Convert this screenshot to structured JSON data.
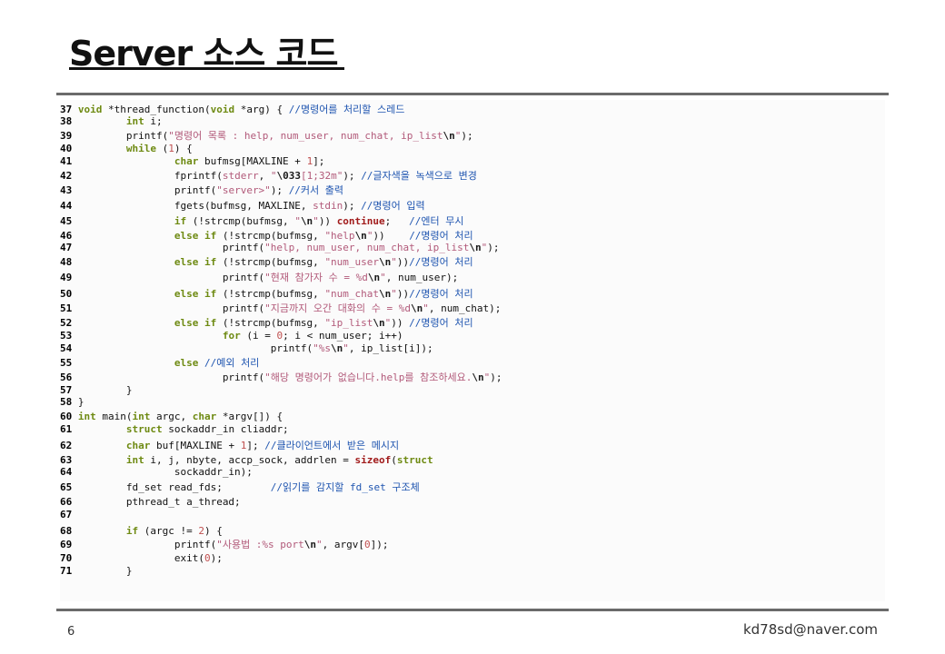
{
  "slide": {
    "title": "Server 소스 코드",
    "page_number": "6",
    "email": "kd78sd@naver.com"
  },
  "code_lines": [
    {
      "n": "37",
      "t": "void *thread_function(void *arg) { //명령어를 처리할 스레드"
    },
    {
      "n": "38",
      "t": "        int i;"
    },
    {
      "n": "39",
      "t": "        printf(\"명령어 목록 : help, num_user, num_chat, ip_list\\n\");"
    },
    {
      "n": "40",
      "t": "        while (1) {"
    },
    {
      "n": "41",
      "t": "                char bufmsg[MAXLINE + 1];"
    },
    {
      "n": "42",
      "t": "                fprintf(stderr, \"\\033[1;32m\"); //글자색을 녹색으로 변경"
    },
    {
      "n": "43",
      "t": "                printf(\"server>\"); //커서 출력"
    },
    {
      "n": "44",
      "t": "                fgets(bufmsg, MAXLINE, stdin); //명령어 입력"
    },
    {
      "n": "45",
      "t": "                if (!strcmp(bufmsg, \"\\n\")) continue;   //엔터 무시"
    },
    {
      "n": "46",
      "t": "                else if (!strcmp(bufmsg, \"help\\n\"))    //명령어 처리"
    },
    {
      "n": "47",
      "t": "                        printf(\"help, num_user, num_chat, ip_list\\n\");"
    },
    {
      "n": "48",
      "t": "                else if (!strcmp(bufmsg, \"num_user\\n\"))//명령어 처리"
    },
    {
      "n": "49",
      "t": "                        printf(\"현재 참가자 수 = %d\\n\", num_user);"
    },
    {
      "n": "50",
      "t": "                else if (!strcmp(bufmsg, \"num_chat\\n\"))//명령어 처리"
    },
    {
      "n": "51",
      "t": "                        printf(\"지금까지 오간 대화의 수 = %d\\n\", num_chat);"
    },
    {
      "n": "52",
      "t": "                else if (!strcmp(bufmsg, \"ip_list\\n\")) //명령어 처리"
    },
    {
      "n": "53",
      "t": "                        for (i = 0; i < num_user; i++)"
    },
    {
      "n": "54",
      "t": "                                printf(\"%s\\n\", ip_list[i]);"
    },
    {
      "n": "55",
      "t": "                else //예외 처리"
    },
    {
      "n": "56",
      "t": "                        printf(\"해당 명령어가 없습니다.help를 참조하세요.\\n\");"
    },
    {
      "n": "57",
      "t": "        }"
    },
    {
      "n": "58",
      "t": "}"
    },
    {
      "n": "60",
      "t": "int main(int argc, char *argv[]) {"
    },
    {
      "n": "61",
      "t": "        struct sockaddr_in cliaddr;"
    },
    {
      "n": "62",
      "t": "        char buf[MAXLINE + 1]; //클라이언트에서 받은 메시지"
    },
    {
      "n": "63",
      "t": "        int i, j, nbyte, accp_sock, addrlen = sizeof(struct"
    },
    {
      "n": "64",
      "t": "                sockaddr_in);"
    },
    {
      "n": "65",
      "t": "        fd_set read_fds;        //읽기를 감지할 fd_set 구조체"
    },
    {
      "n": "66",
      "t": "        pthread_t a_thread;"
    },
    {
      "n": "67",
      "t": ""
    },
    {
      "n": "68",
      "t": "        if (argc != 2) {"
    },
    {
      "n": "69",
      "t": "                printf(\"사용법 :%s port\\n\", argv[0]);"
    },
    {
      "n": "70",
      "t": "                exit(0);"
    },
    {
      "n": "71",
      "t": "        }"
    }
  ]
}
